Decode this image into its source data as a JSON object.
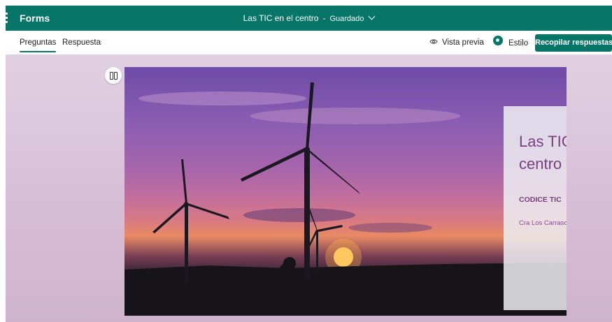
{
  "app": {
    "name": "Forms"
  },
  "document": {
    "title": "Las TIC en el centro",
    "separator": "-",
    "save_status": "Guardado"
  },
  "tabs": [
    {
      "label": "Preguntas",
      "selected": true
    },
    {
      "label": "Respuestas",
      "selected": false
    }
  ],
  "toolbar": {
    "preview_label": "Vista previa",
    "style_label": "Estilo",
    "collect_label": "Recopilar respuestas"
  },
  "form": {
    "title": "Las TIC en el centro",
    "subtitle": "CODICE TIC",
    "description": "Cra Los Carrascales"
  },
  "icons": {
    "waffle": "app-launcher-icon",
    "chevron": "chevron-down-icon",
    "preview": "eye-icon",
    "style": "palette-icon",
    "layout": "layout-toggle-icon"
  },
  "colors": {
    "accent": "#077568",
    "title_text": "#7a3f7f",
    "canvas_background": "#d8c2d8"
  }
}
